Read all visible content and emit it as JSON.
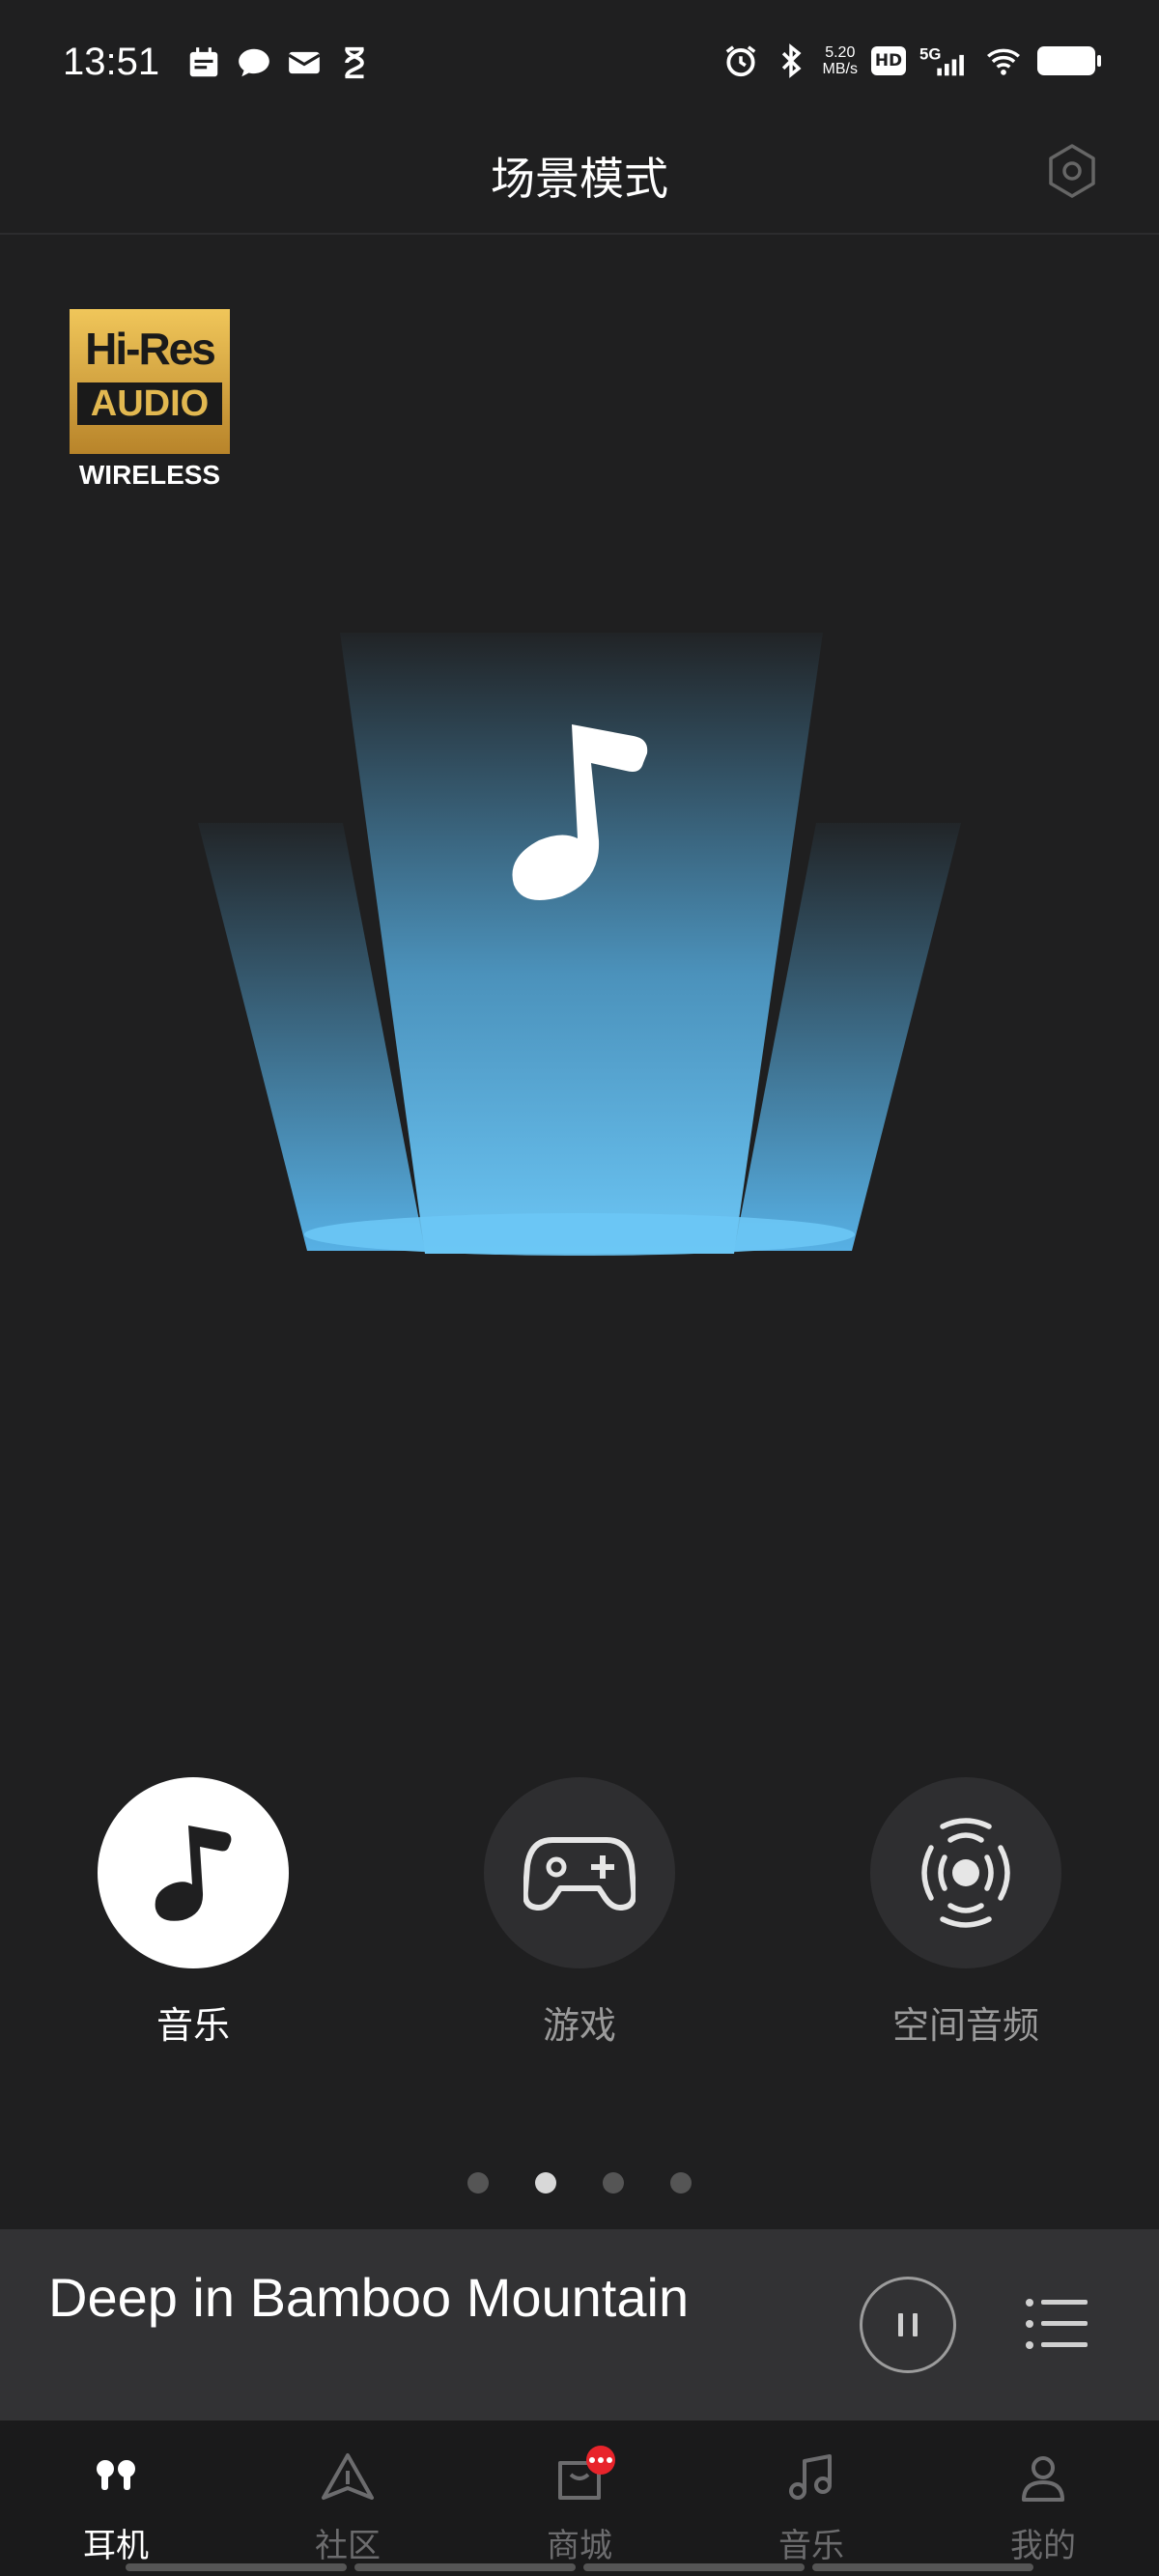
{
  "status_bar": {
    "time": "13:51",
    "net_speed_value": "5.20",
    "net_speed_unit": "MB/s",
    "hd_label": "HD",
    "signal_label": "5G"
  },
  "header": {
    "title": "场景模式",
    "settings_icon": "hexagon-settings-icon"
  },
  "badge_logo": {
    "line1": "Hi-Res",
    "line2": "AUDIO",
    "line3": "WIRELESS"
  },
  "modes": {
    "items": [
      {
        "label": "音乐",
        "icon": "music-note-icon",
        "active": true
      },
      {
        "label": "游戏",
        "icon": "gamepad-icon",
        "active": false
      },
      {
        "label": "空间音频",
        "icon": "spatial-audio-icon",
        "active": false
      }
    ]
  },
  "pager": {
    "count": 4,
    "active_index": 1
  },
  "player": {
    "track_title": "Deep in Bamboo Mountain",
    "pause_icon": "pause-icon",
    "playlist_icon": "playlist-icon"
  },
  "tabs": {
    "items": [
      {
        "label": "耳机",
        "icon": "earbuds-icon",
        "active": true
      },
      {
        "label": "社区",
        "icon": "community-triangle-icon",
        "active": false
      },
      {
        "label": "商城",
        "icon": "shop-bag-icon",
        "active": false,
        "badge": true
      },
      {
        "label": "音乐",
        "icon": "music-icon",
        "active": false
      },
      {
        "label": "我的",
        "icon": "profile-icon",
        "active": false
      }
    ]
  },
  "colors": {
    "background": "#1f1f20",
    "accent_blue": "#5ab8ef",
    "badge_red": "#e8242b"
  }
}
